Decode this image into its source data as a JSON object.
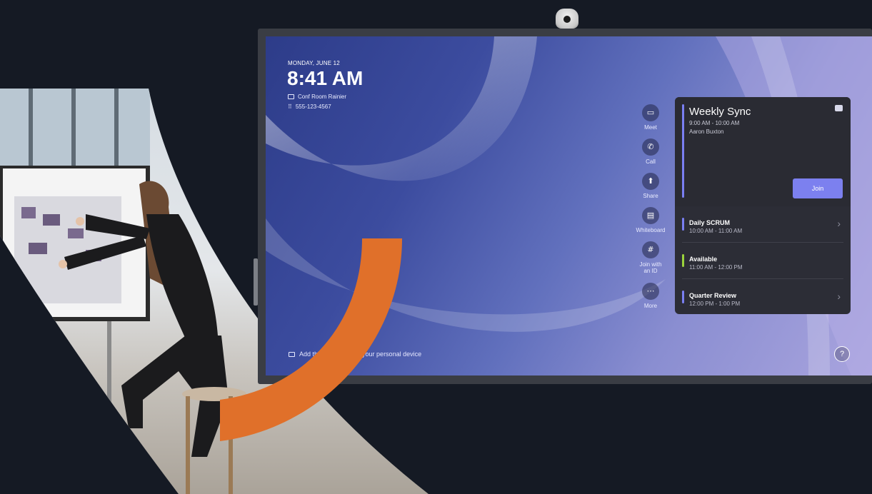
{
  "screen": {
    "date": "MONDAY, JUNE 12",
    "time": "8:41 AM",
    "room": "Conf Room Rainier",
    "phone": "555-123-4567"
  },
  "actions": [
    {
      "label": "Meet",
      "icon": "video-icon",
      "glyph": "▭"
    },
    {
      "label": "Call",
      "icon": "phone-icon",
      "glyph": "✆"
    },
    {
      "label": "Share",
      "icon": "share-icon",
      "glyph": "⬆"
    },
    {
      "label": "Whiteboard",
      "icon": "whiteboard-icon",
      "glyph": "▤"
    },
    {
      "label": "Join with an ID",
      "icon": "hash-icon",
      "glyph": "#"
    },
    {
      "label": "More",
      "icon": "more-icon",
      "glyph": "⋯"
    }
  ],
  "current_meeting": {
    "title": "Weekly Sync",
    "time": "9:00 AM - 10:00 AM",
    "organizer": "Aaron Buxton",
    "join_label": "Join"
  },
  "agenda": [
    {
      "title": "Daily SCRUM",
      "time": "10:00 AM - 11:00 AM",
      "color": "#7a7ff2"
    },
    {
      "title": "Available",
      "time": "11:00 AM - 12:00 PM",
      "color": "#9bd33c"
    },
    {
      "title": "Quarter Review",
      "time": "12:00 PM - 1:00 PM",
      "color": "#7a7ff2"
    }
  ],
  "hint": "Add this meeting with your personal device",
  "help_label": "?",
  "colors": {
    "accent": "#7c80ef",
    "orange": "#e0702a",
    "background": "#151a24"
  }
}
